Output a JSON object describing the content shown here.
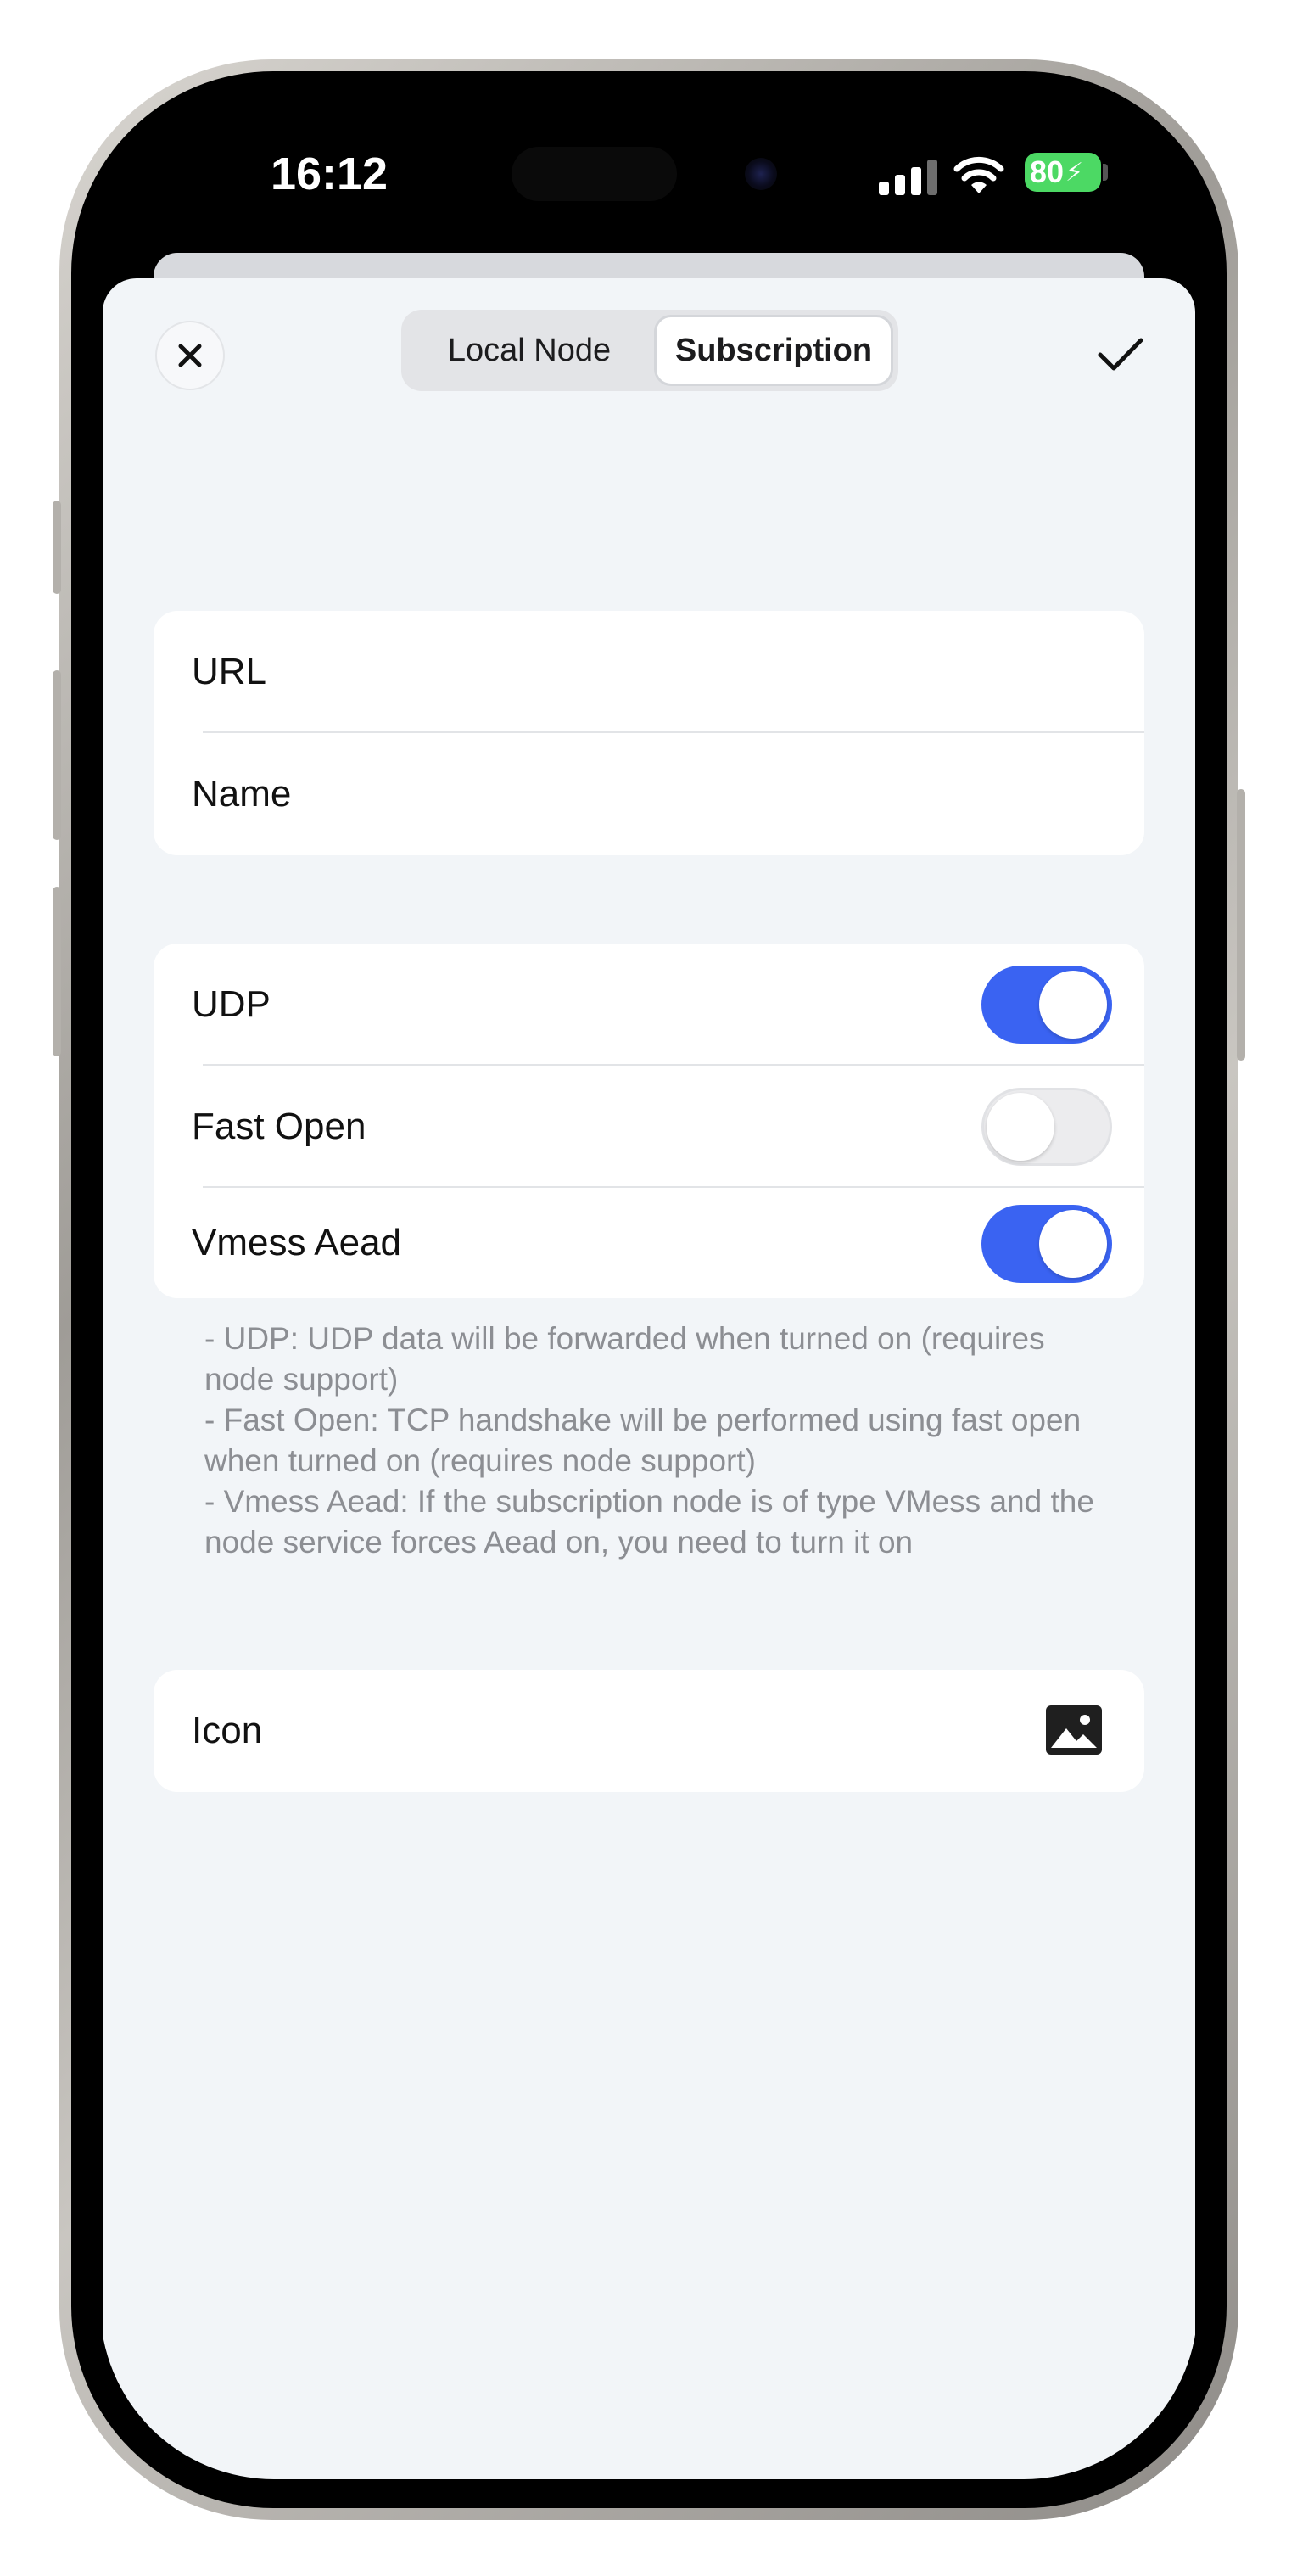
{
  "status_bar": {
    "time": "16:12",
    "battery": "80"
  },
  "header": {
    "close_icon": "close-icon",
    "segments": [
      "Local Node",
      "Subscription"
    ],
    "selected_segment": "Subscription",
    "confirm_icon": "checkmark-icon"
  },
  "fields": {
    "url_label": "URL",
    "name_label": "Name"
  },
  "options": {
    "udp": {
      "label": "UDP",
      "on": true
    },
    "fast_open": {
      "label": "Fast Open",
      "on": false
    },
    "vmess_aead": {
      "label": "Vmess Aead",
      "on": true
    }
  },
  "help_lines": [
    "- UDP: UDP data will be forwarded when turned on (requires node support)",
    "- Fast Open: TCP handshake will be performed using fast open when turned on (requires node support)",
    "- Vmess Aead: If the subscription node is of type VMess and the node service forces Aead on, you need to turn it on"
  ],
  "icon_row": {
    "label": "Icon",
    "icon": "image-icon"
  },
  "colors": {
    "accent": "#3a63f2",
    "background": "#f2f5f8",
    "battery": "#4cd964"
  }
}
